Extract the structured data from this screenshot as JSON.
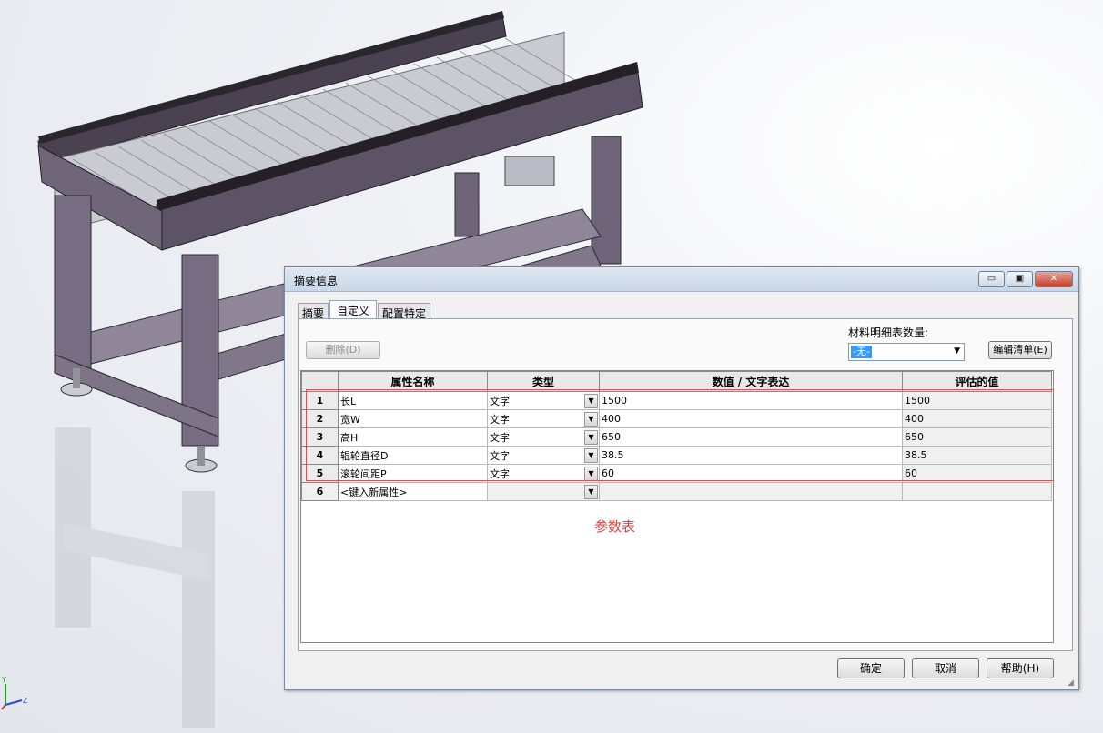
{
  "dialog": {
    "title": "摘要信息",
    "window_buttons": {
      "minimize": "▭",
      "maximize": "▣",
      "close": "✕"
    }
  },
  "tabs": [
    {
      "label": "摘要"
    },
    {
      "label": "自定义",
      "active": true
    },
    {
      "label": "配置特定"
    }
  ],
  "toolbar": {
    "delete_label": "删除(D)",
    "bom_quantity_label": "材料明细表数量:",
    "bom_quantity_value": "-无-",
    "edit_list_label": "编辑清单(E)"
  },
  "table": {
    "columns": [
      "",
      "属性名称",
      "类型",
      "数值 / 文字表达",
      "评估的值"
    ],
    "rows": [
      {
        "num": "1",
        "name": "长L",
        "type": "文字",
        "value": "1500",
        "evaluated": "1500"
      },
      {
        "num": "2",
        "name": "宽W",
        "type": "文字",
        "value": "400",
        "evaluated": "400"
      },
      {
        "num": "3",
        "name": "高H",
        "type": "文字",
        "value": "650",
        "evaluated": "650"
      },
      {
        "num": "4",
        "name": "辊轮直径D",
        "type": "文字",
        "value": "38.5",
        "evaluated": "38.5"
      },
      {
        "num": "5",
        "name": "滚轮间距P",
        "type": "文字",
        "value": "60",
        "evaluated": "60"
      }
    ],
    "new_row": {
      "num": "6",
      "name": "<键入新属性>"
    }
  },
  "annotation": "参数表",
  "footer": {
    "ok_label": "确定",
    "cancel_label": "取消",
    "help_label": "帮助(H)"
  },
  "triad": {
    "y": "Y",
    "z": "Z"
  },
  "colors": {
    "highlight": "#e05050",
    "frame": "#5a4f63",
    "accent_blue": "#3399ff"
  }
}
